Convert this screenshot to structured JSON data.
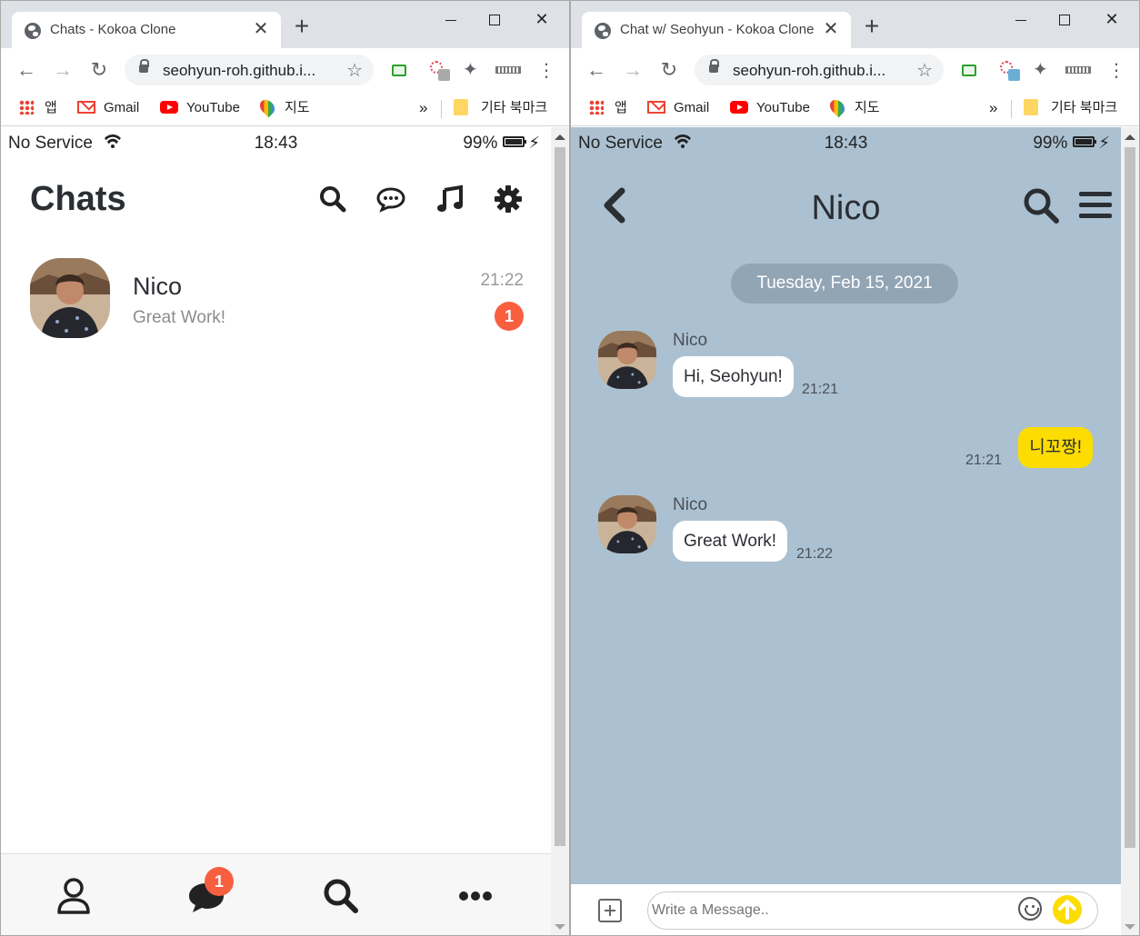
{
  "browser_left": {
    "tab_title": "Chats - Kokoa Clone",
    "url": "seohyun-roh.github.i...",
    "bookmarks": {
      "apps": "앱",
      "gmail": "Gmail",
      "youtube": "YouTube",
      "maps": "지도",
      "overflow": "»",
      "other": "기타 북마크"
    }
  },
  "browser_right": {
    "tab_title": "Chat w/ Seohyun - Kokoa Clone",
    "url": "seohyun-roh.github.i...",
    "bookmarks": {
      "apps": "앱",
      "gmail": "Gmail",
      "youtube": "YouTube",
      "maps": "지도",
      "overflow": "»",
      "other": "기타 북마크"
    }
  },
  "status_bar": {
    "carrier": "No Service",
    "time": "18:43",
    "battery": "99%"
  },
  "chats_screen": {
    "title": "Chats",
    "chats": [
      {
        "name": "Nico",
        "preview": "Great Work!",
        "time": "21:22",
        "unread": "1"
      }
    ],
    "tab_bar": {
      "chats_badge": "1"
    }
  },
  "chat_room": {
    "title": "Nico",
    "date_divider": "Tuesday, Feb 15, 2021",
    "messages": [
      {
        "sender": "Nico",
        "text": "Hi, Seohyun!",
        "time": "21:21",
        "mine": false
      },
      {
        "sender": "",
        "text": "니꼬짱!",
        "time": "21:21",
        "mine": true
      },
      {
        "sender": "Nico",
        "text": "Great Work!",
        "time": "21:22",
        "mine": false
      }
    ],
    "composer": {
      "placeholder": "Write a Message.."
    }
  },
  "colors": {
    "room_background": "#abc1d1",
    "my_bubble": "#fddc02",
    "badge": "#f85f3f",
    "date_pill": "#92a5b5"
  }
}
